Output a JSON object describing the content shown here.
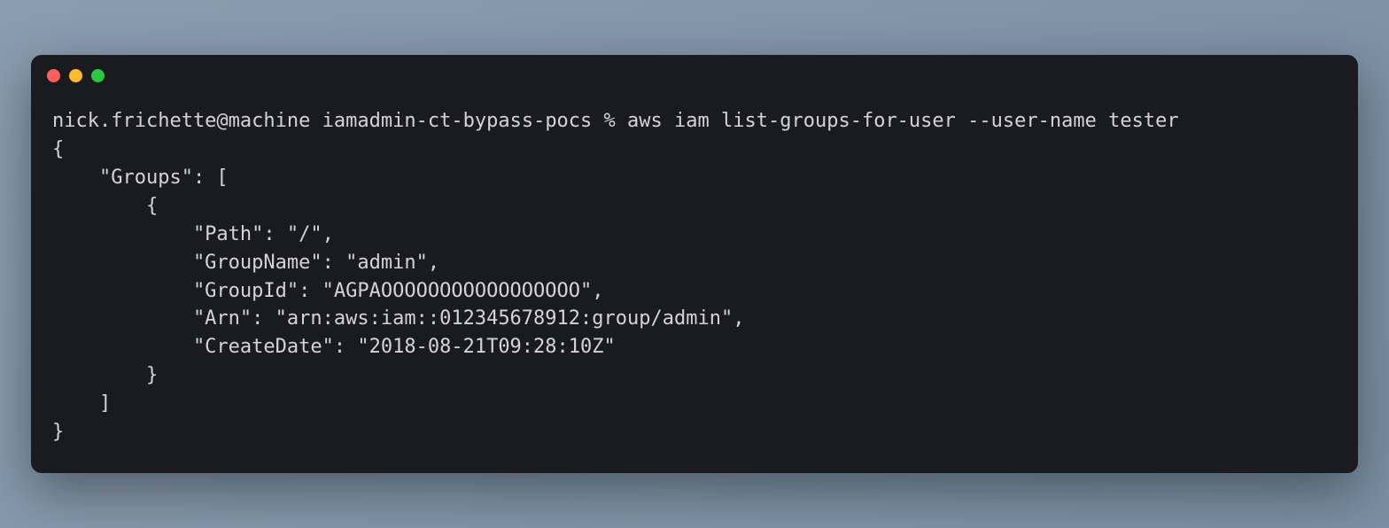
{
  "terminal": {
    "prompt_user": "nick.frichette@machine",
    "prompt_dir": "iamadmin-ct-bypass-pocs",
    "prompt_symbol": "%",
    "command": "aws iam list-groups-for-user --user-name tester",
    "output_lines": {
      "l0": "{",
      "l1": "    \"Groups\": [",
      "l2": "        {",
      "l3": "            \"Path\": \"/\",",
      "l4": "            \"GroupName\": \"admin\",",
      "l5": "            \"GroupId\": \"AGPAOOOOOOOOOOOOOOOOO\",",
      "l6": "            \"Arn\": \"arn:aws:iam::012345678912:group/admin\",",
      "l7": "            \"CreateDate\": \"2018-08-21T09:28:10Z\"",
      "l8": "        }",
      "l9": "    ]",
      "l10": "}"
    }
  }
}
